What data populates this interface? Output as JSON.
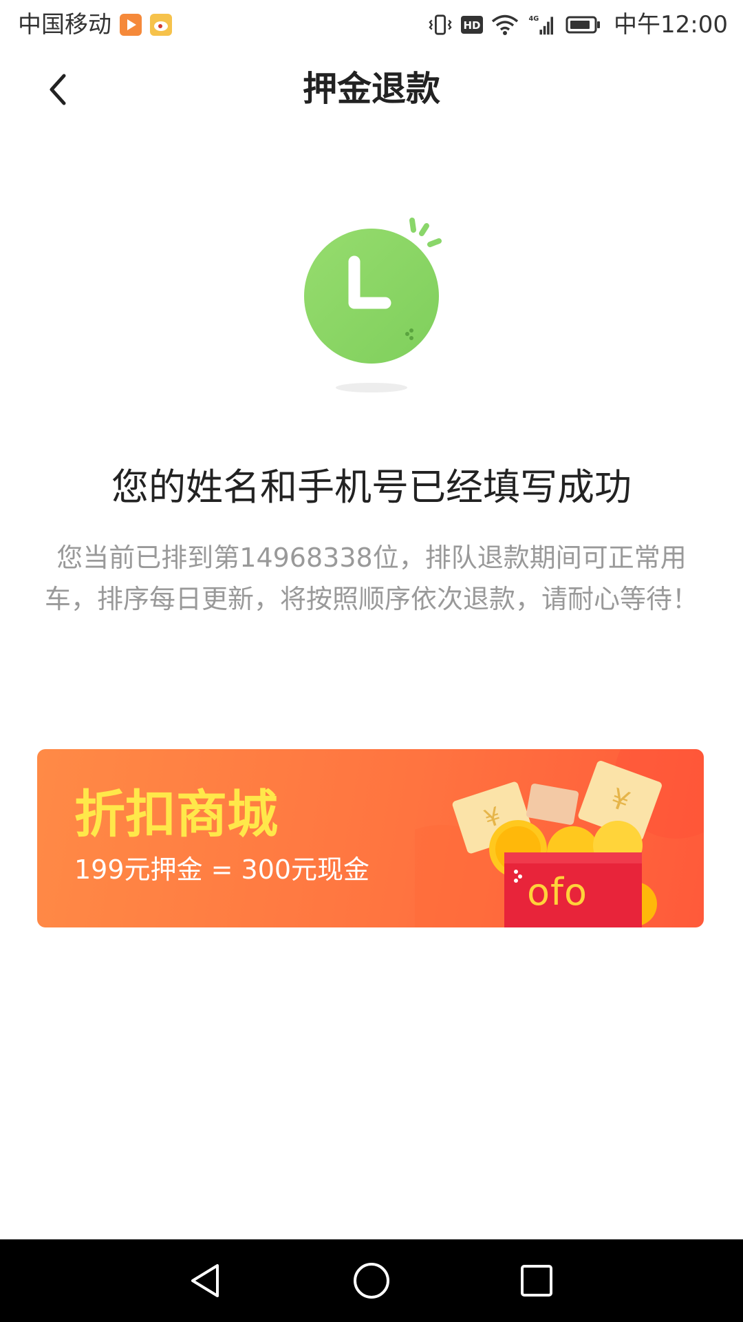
{
  "status_bar": {
    "carrier": "中国移动",
    "network": "4G",
    "time": "中午12:00",
    "icons": [
      "video-app-icon",
      "weibo-app-icon",
      "vibrate-icon",
      "hd-icon",
      "wifi-icon",
      "signal-icon",
      "battery-icon"
    ]
  },
  "nav": {
    "title": "押金退款",
    "back_icon": "chevron-left-icon"
  },
  "illustration": {
    "icon": "clock-icon",
    "color": "#8ad66a"
  },
  "message": {
    "headline": "您的姓名和手机号已经填写成功",
    "description": "您当前已排到第14968338位，排队退款期间可正常用车，排序每日更新，将按照顺序依次退款，请耐心等待！"
  },
  "banner": {
    "title": "折扣商城",
    "subtitle": "199元押金 = 300元现金",
    "brand": "ofo",
    "title_color": "#ffe84a",
    "background_color": "#ff7440"
  },
  "system_nav": {
    "items": [
      "back-triangle-icon",
      "home-circle-icon",
      "recents-square-icon"
    ]
  }
}
